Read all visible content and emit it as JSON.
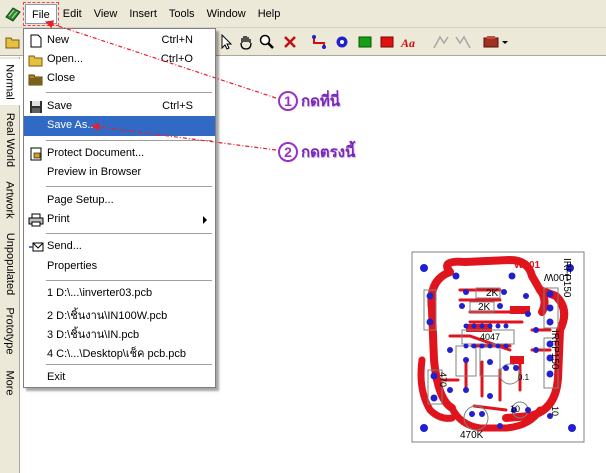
{
  "menubar": {
    "items": [
      "File",
      "Edit",
      "View",
      "Insert",
      "Tools",
      "Window",
      "Help"
    ]
  },
  "sidebar": {
    "tabs": [
      "Normal",
      "Real World",
      "Artwork",
      "Unpopulated",
      "Prototype",
      "More"
    ]
  },
  "file_menu": {
    "items": [
      {
        "label": "New",
        "shortcut": "Ctrl+N",
        "icon": "new-document-icon"
      },
      {
        "label": "Open...",
        "shortcut": "Ctrl+O",
        "icon": "open-folder-icon"
      },
      {
        "label": "Close",
        "shortcut": "",
        "icon": "close-folder-icon"
      },
      {
        "label": "Save",
        "shortcut": "Ctrl+S",
        "icon": "save-disk-icon"
      },
      {
        "label": "Save As...",
        "shortcut": "",
        "icon": ""
      },
      {
        "label": "Protect Document...",
        "shortcut": "",
        "icon": "protect-document-icon"
      },
      {
        "label": "Preview in Browser",
        "shortcut": "",
        "icon": ""
      },
      {
        "label": "Page Setup...",
        "shortcut": "",
        "icon": ""
      },
      {
        "label": "Print",
        "shortcut": "",
        "icon": "printer-icon"
      },
      {
        "label": "Send...",
        "shortcut": "",
        "icon": "send-icon"
      },
      {
        "label": "Properties",
        "shortcut": "",
        "icon": ""
      },
      {
        "label": "1 D:\\...\\inverter03.pcb",
        "shortcut": "",
        "icon": ""
      },
      {
        "label": "2 D:\\ชิ้นงาน\\IN100W.pcb",
        "shortcut": "",
        "icon": ""
      },
      {
        "label": "3 D:\\ชิ้นงาน\\IN.pcb",
        "shortcut": "",
        "icon": ""
      },
      {
        "label": "4 C:\\...\\Desktop\\เช็ค pcb.pcb",
        "shortcut": "",
        "icon": ""
      },
      {
        "label": "Exit",
        "shortcut": "",
        "icon": ""
      }
    ]
  },
  "annotations": [
    {
      "number": "1",
      "text": "กดที่นี่"
    },
    {
      "number": "2",
      "text": "กดตรงนี้"
    }
  ],
  "pcb": {
    "labels": {
      "title": "W001",
      "power": "100W",
      "r1": "2K",
      "r2": "2K",
      "c1": "4047",
      "q1": "IRFP150",
      "q2": "IRFP150",
      "r3": "470",
      "r4": "470K",
      "r5": "10",
      "r6": "10",
      "r7": "0.1"
    },
    "trace_color": "#e0141c",
    "pad_color": "#2020d0"
  },
  "colors": {
    "menu_bg": "#ece9d8",
    "highlight": "#316ac5",
    "annotation": "#9b30c8",
    "arrow": "#e8202a"
  }
}
